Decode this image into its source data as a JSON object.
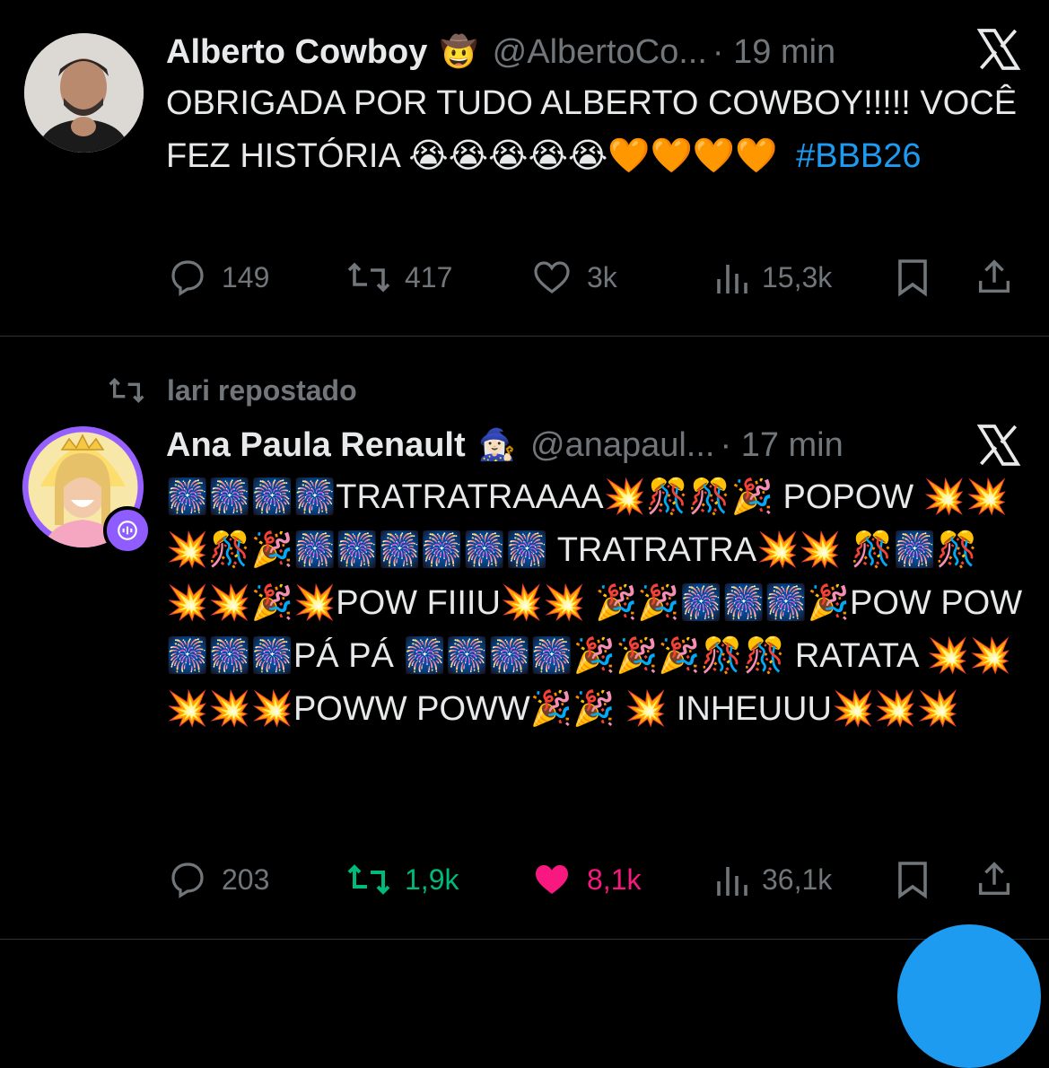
{
  "colors": {
    "background": "#000000",
    "text": "#e7e9ea",
    "muted": "#71767b",
    "link": "#1d9bf0",
    "repost_active": "#00ba7c",
    "like_active": "#f91880",
    "divider": "#2f3336"
  },
  "tweets": [
    {
      "display_name": "Alberto Cowboy",
      "name_badge": "🤠",
      "handle": "@AlbertoCo...",
      "time": "· 19 min",
      "text": "OBRIGADA POR TUDO ALBERTO COWBOY!!!!! VOCÊ FEZ HISTÓRIA 😭😭😭😭😭🧡🧡🧡🧡",
      "hashtag": "#BBB26",
      "avatar_icon": "avatar-photo",
      "actions": {
        "replies": "149",
        "reposts": "417",
        "likes": "3k",
        "views": "15,3k"
      }
    },
    {
      "reposted_by": "lari repostado",
      "display_name": "Ana Paula Renault",
      "name_badge": "🧙🏻‍♀️",
      "handle": "@anapaul...",
      "time": "· 17 min",
      "text": "🎆🎆🎆🎆TRATRATRAAAA💥🎊🎊🎉 POPOW 💥💥💥🎊🎉🎆🎆🎆🎆🎆🎆 TRATRATRA💥💥 🎊🎆🎊 💥💥🎉💥POW FIIIU💥💥 🎉🎉🎆🎆🎆🎉POW POW🎆🎆🎆PÁ PÁ 🎆🎆🎆🎆🎉🎉🎉🎊🎊 RATATA 💥💥💥💥💥POWW POWW🎉🎉 💥 INHEUUU💥💥💥",
      "avatar_icon": "avatar-photo",
      "actions": {
        "replies": "203",
        "reposts": "1,9k",
        "likes": "8,1k",
        "views": "36,1k"
      }
    }
  ]
}
